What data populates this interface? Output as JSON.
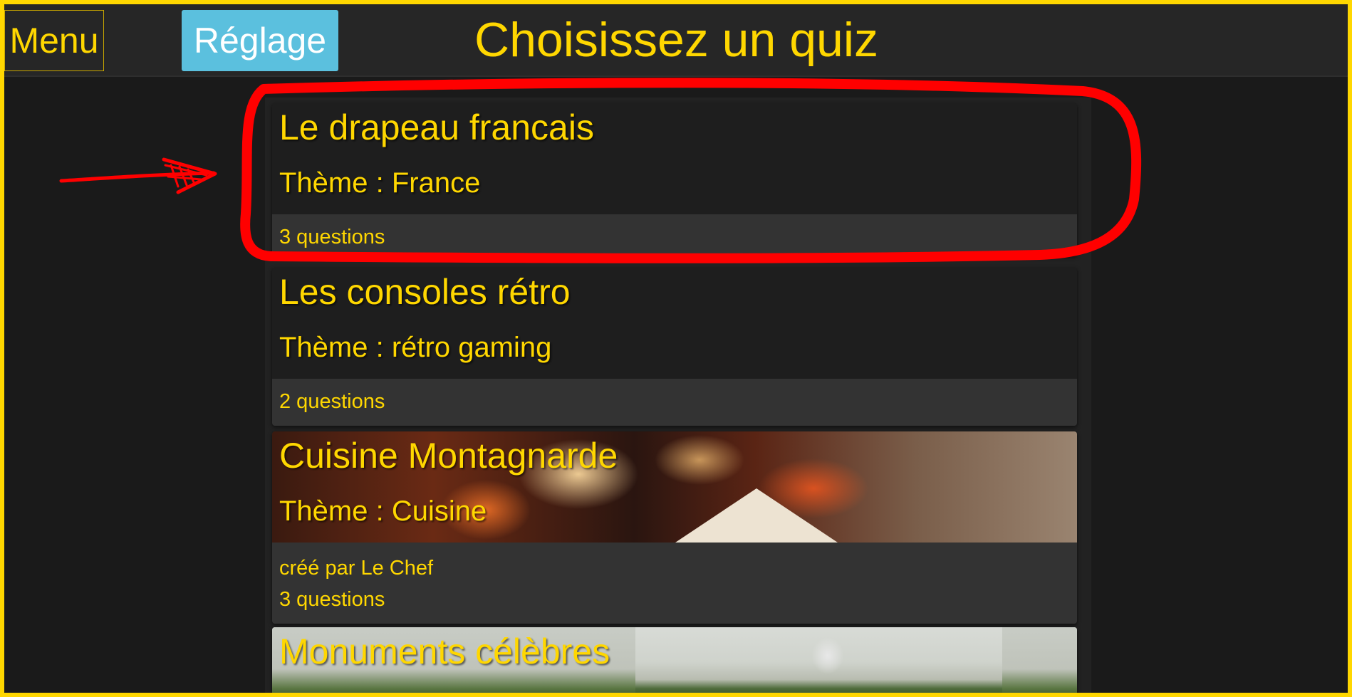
{
  "header": {
    "menu_label": "Menu",
    "settings_label": "Réglage",
    "title": "Choisissez un quiz"
  },
  "quizzes": [
    {
      "title": "Le drapeau francais",
      "theme": "Thème : France",
      "author": "",
      "question_count": "3 questions",
      "background": "none"
    },
    {
      "title": "Les consoles rétro",
      "theme": "Thème : rétro gaming",
      "author": "",
      "question_count": "2 questions",
      "background": "none"
    },
    {
      "title": "Cuisine Montagnarde",
      "theme": "Thème : Cuisine",
      "author": "créé par Le Chef",
      "question_count": "3 questions",
      "background": "campfire-photo"
    },
    {
      "title": "Monuments célèbres",
      "theme": "",
      "author": "",
      "question_count": "",
      "background": "taj-mahal-photo"
    }
  ],
  "annotation": {
    "type": "hand-drawn-red-circle-and-arrow",
    "target": "quiz-card-1",
    "color": "#ff0000"
  },
  "colors": {
    "accent": "#ffd700",
    "settings_button": "#5bc0de",
    "background": "#1a1a1a",
    "card": "#1e1e1e",
    "card_footer": "#333333"
  }
}
